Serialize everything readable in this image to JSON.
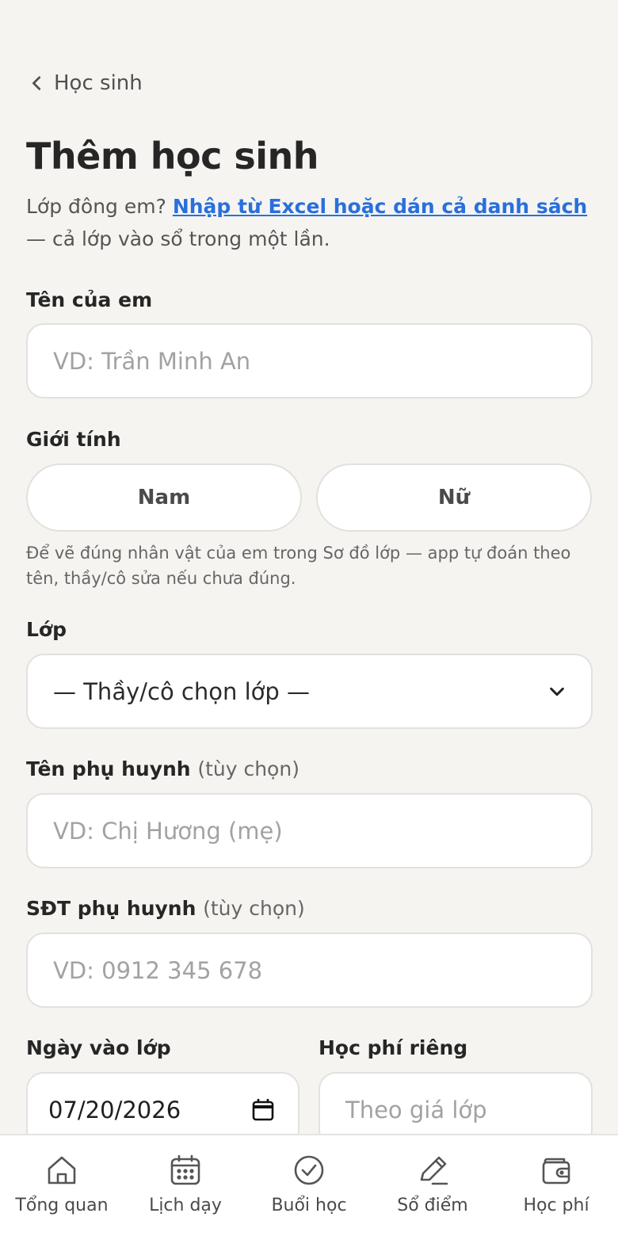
{
  "header": {
    "back_label": "Học sinh",
    "title": "Thêm học sinh",
    "intro_prefix": "Lớp đông em?",
    "intro_link": "Nhập từ Excel hoặc dán cả danh sách",
    "intro_suffix": "— cả lớp vào sổ trong một lần."
  },
  "form": {
    "name": {
      "label": "Tên của em",
      "placeholder": "VD: Trần Minh An"
    },
    "gender": {
      "label": "Giới tính",
      "options": [
        "Nam",
        "Nữ"
      ],
      "hint": "Để vẽ đúng nhân vật của em trong Sơ đồ lớp — app tự đoán theo tên, thầy/cô sửa nếu chưa đúng."
    },
    "class": {
      "label": "Lớp",
      "selected": "— Thầy/cô chọn lớp —"
    },
    "parent_name": {
      "label": "Tên phụ huynh",
      "optional": "(tùy chọn)",
      "placeholder": "VD: Chị Hương (mẹ)"
    },
    "parent_phone": {
      "label": "SĐT phụ huynh",
      "optional": "(tùy chọn)",
      "placeholder": "VD: 0912 345 678"
    },
    "join_date": {
      "label": "Ngày vào lớp",
      "value": "07/20/2026"
    },
    "custom_fee": {
      "label": "Học phí riêng",
      "placeholder": "Theo giá lớp"
    }
  },
  "tabs": [
    {
      "label": "Tổng quan",
      "icon": "home-icon"
    },
    {
      "label": "Lịch dạy",
      "icon": "calendar-icon"
    },
    {
      "label": "Buổi học",
      "icon": "check-circle-icon"
    },
    {
      "label": "Sổ điểm",
      "icon": "pencil-icon"
    },
    {
      "label": "Học phí",
      "icon": "wallet-icon"
    }
  ],
  "colors": {
    "background": "#f5f4f1",
    "link": "#2a6fdb",
    "text": "#262626"
  }
}
